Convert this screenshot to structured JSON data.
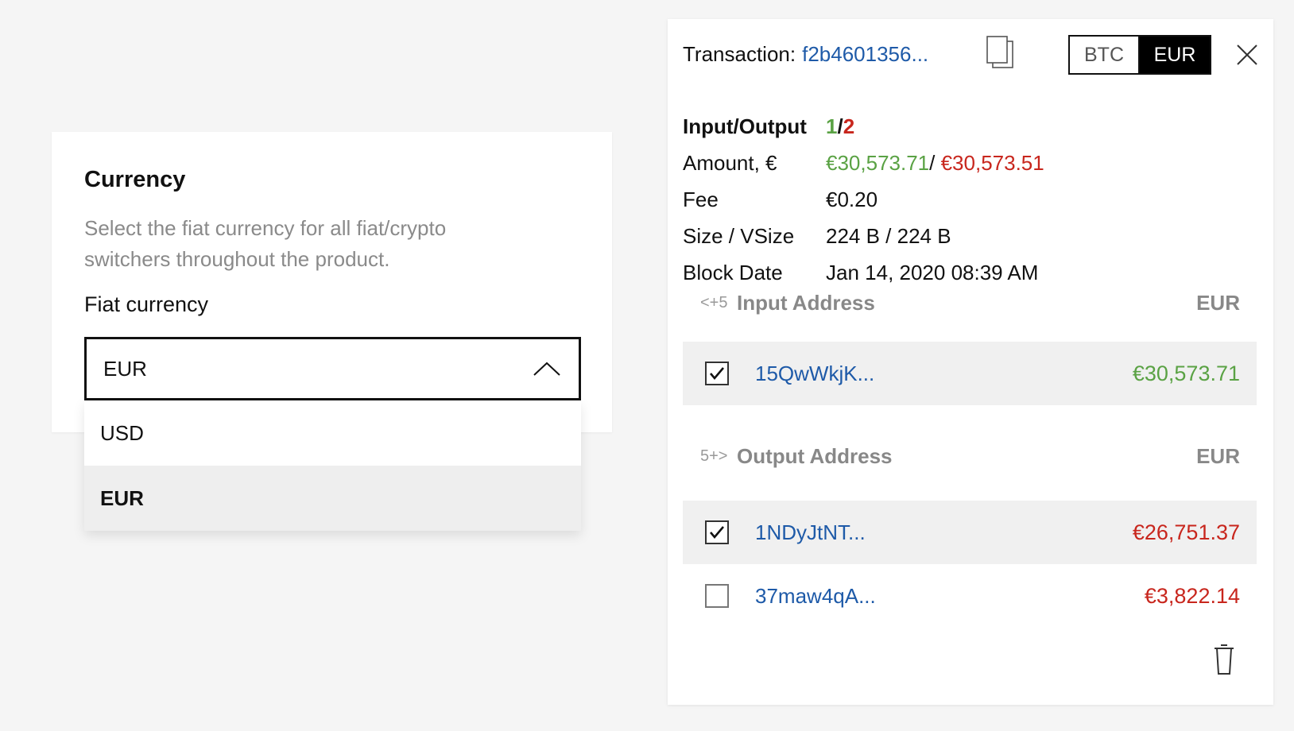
{
  "settings": {
    "title": "Currency",
    "description": "Select the fiat currency for all fiat/crypto switchers throughout the product.",
    "field_label": "Fiat currency",
    "selected_value": "EUR",
    "options": [
      "USD",
      "EUR"
    ]
  },
  "transaction": {
    "label": "Transaction:",
    "hash": "f2b4601356...",
    "toggle": {
      "btc": "BTC",
      "eur": "EUR",
      "active": "EUR"
    },
    "io": {
      "key": "Input/Output",
      "inputs": "1",
      "sep": "/",
      "outputs": "2"
    },
    "amount": {
      "key": "Amount, €",
      "in": "€30,573.71",
      "sep": "/ ",
      "out": "€30,573.51"
    },
    "fee": {
      "key": "Fee",
      "value": "€0.20"
    },
    "size": {
      "key": "Size / VSize",
      "value": "224 B / 224 B"
    },
    "block_date": {
      "key": "Block Date",
      "value": "Jan 14, 2020 08:39 AM"
    },
    "inputs": {
      "nav": "<+5",
      "title": "Input Address",
      "currency": "EUR",
      "rows": [
        {
          "address": "15QwWkjK...",
          "amount": "€30,573.71",
          "checked": true
        }
      ]
    },
    "outputs": {
      "nav": "5+>",
      "title": "Output Address",
      "currency": "EUR",
      "rows": [
        {
          "address": "1NDyJtNT...",
          "amount": "€26,751.37",
          "checked": true
        },
        {
          "address": "37maw4qA...",
          "amount": "€3,822.14",
          "checked": false
        }
      ]
    }
  },
  "colors": {
    "green": "#5aa244",
    "red": "#c8261d",
    "link": "#1e5aa8"
  },
  "icons": [
    "chevron-up-icon",
    "copy-icon",
    "close-icon",
    "checkbox-icon",
    "trash-icon"
  ]
}
